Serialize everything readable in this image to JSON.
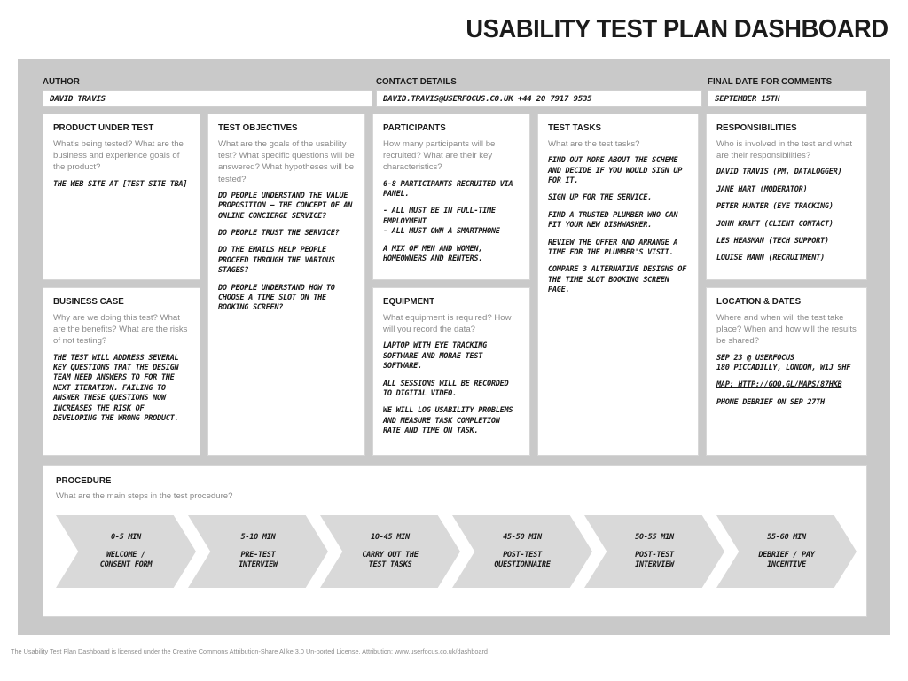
{
  "header": {
    "title": "USABILITY TEST PLAN DASHBOARD"
  },
  "top_fields": {
    "author": {
      "label": "AUTHOR",
      "value": "DAVID TRAVIS"
    },
    "contact": {
      "label": "CONTACT DETAILS",
      "value": "DAVID.TRAVIS@USERFOCUS.CO.UK  +44 20 7917 9535"
    },
    "final": {
      "label": "FINAL DATE FOR COMMENTS",
      "value": "SEPTEMBER 15TH"
    }
  },
  "cards": {
    "product_under_test": {
      "title": "PRODUCT UNDER TEST",
      "prompt": "What's being tested? What are the business and experience goals of the product?",
      "answers": [
        "THE WEB SITE AT [TEST SITE TBA]"
      ]
    },
    "business_case": {
      "title": "BUSINESS CASE",
      "prompt": "Why are we doing this test? What are the benefits? What are the risks of not testing?",
      "answers": [
        "THE TEST WILL ADDRESS SEVERAL KEY QUESTIONS THAT THE DESIGN TEAM NEED ANSWERS TO FOR THE NEXT ITERATION. FAILING TO ANSWER THESE QUESTIONS NOW INCREASES THE RISK OF DEVELOPING THE WRONG PRODUCT."
      ]
    },
    "test_objectives": {
      "title": "TEST OBJECTIVES",
      "prompt": "What are the goals of the usability test? What specific questions will be answered? What hypotheses will be tested?",
      "answers": [
        "DO PEOPLE UNDERSTAND THE VALUE PROPOSITION — THE CONCEPT OF AN ONLINE CONCIERGE SERVICE?",
        "DO PEOPLE TRUST THE SERVICE?",
        "DO THE EMAILS HELP PEOPLE PROCEED THROUGH THE VARIOUS STAGES?",
        "DO PEOPLE UNDERSTAND HOW TO CHOOSE A TIME SLOT ON THE BOOKING SCREEN?"
      ]
    },
    "participants": {
      "title": "PARTICIPANTS",
      "prompt": "How many participants will be recruited? What are their key characteristics?",
      "answers": [
        "6-8 PARTICIPANTS RECRUITED VIA PANEL.",
        "- ALL MUST BE IN FULL-TIME EMPLOYMENT\n- ALL MUST OWN A SMARTPHONE",
        "A MIX OF MEN AND WOMEN, HOMEOWNERS AND RENTERS."
      ]
    },
    "equipment": {
      "title": "EQUIPMENT",
      "prompt": "What equipment is required? How will you record the data?",
      "answers": [
        "LAPTOP WITH EYE TRACKING SOFTWARE AND MORAE TEST SOFTWARE.",
        "ALL SESSIONS WILL BE RECORDED TO DIGITAL VIDEO.",
        "WE WILL LOG USABILITY PROBLEMS AND MEASURE TASK COMPLETION RATE AND TIME ON TASK."
      ]
    },
    "test_tasks": {
      "title": "TEST TASKS",
      "prompt": "What are the test tasks?",
      "answers": [
        "FIND OUT MORE ABOUT THE SCHEME AND DECIDE IF YOU WOULD SIGN UP FOR IT.",
        "SIGN UP FOR THE SERVICE.",
        "FIND A TRUSTED PLUMBER WHO CAN FIT YOUR NEW DISHWASHER.",
        "REVIEW THE OFFER AND ARRANGE A TIME FOR THE PLUMBER'S VISIT.",
        "COMPARE 3 ALTERNATIVE DESIGNS OF THE TIME SLOT BOOKING SCREEN PAGE."
      ]
    },
    "responsibilities": {
      "title": "RESPONSIBILITIES",
      "prompt": "Who is involved in the test and what are their responsibilities?",
      "answers": [
        "DAVID TRAVIS (PM, DATALOGGER)",
        "JANE HART (MODERATOR)",
        "PETER HUNTER (EYE TRACKING)",
        "JOHN KRAFT (CLIENT CONTACT)",
        "LES HEASMAN (TECH SUPPORT)",
        "LOUISE MANN (RECRUITMENT)"
      ]
    },
    "location_dates": {
      "title": "LOCATION & DATES",
      "prompt": "Where and when will the test take place? When and how will the results be shared?",
      "answers": [
        "SEP 23 @ USERFOCUS\n180 PICCADILLY, LONDON, W1J 9HF",
        "MAP: HTTP://GOO.GL/MAPS/87HKB",
        "PHONE DEBRIEF ON SEP 27TH"
      ],
      "link_index": 1
    }
  },
  "procedure": {
    "title": "PROCEDURE",
    "prompt": "What are the main steps in the test procedure?",
    "steps": [
      {
        "time": "0-5 MIN",
        "label": "WELCOME /\nCONSENT FORM"
      },
      {
        "time": "5-10 MIN",
        "label": "PRE-TEST\nINTERVIEW"
      },
      {
        "time": "10-45 MIN",
        "label": "CARRY OUT THE\nTEST TASKS"
      },
      {
        "time": "45-50 MIN",
        "label": "POST-TEST\nQUESTIONNAIRE"
      },
      {
        "time": "50-55 MIN",
        "label": "POST-TEST\nINTERVIEW"
      },
      {
        "time": "55-60 MIN",
        "label": "DEBRIEF / PAY\nINCENTIVE"
      }
    ]
  },
  "footer": {
    "text": "The Usability Test Plan Dashboard is licensed under the Creative Commons Attribution-Share Alike 3.0 Un-ported License. Attribution: www.userfocus.co.uk/dashboard"
  },
  "colors": {
    "panel_background": "#c9c9c9",
    "card_background": "#ffffff",
    "chevron_fill": "#d9d9d9",
    "prompt_text": "#8a8a8a",
    "answer_text": "#1a1a1a"
  }
}
